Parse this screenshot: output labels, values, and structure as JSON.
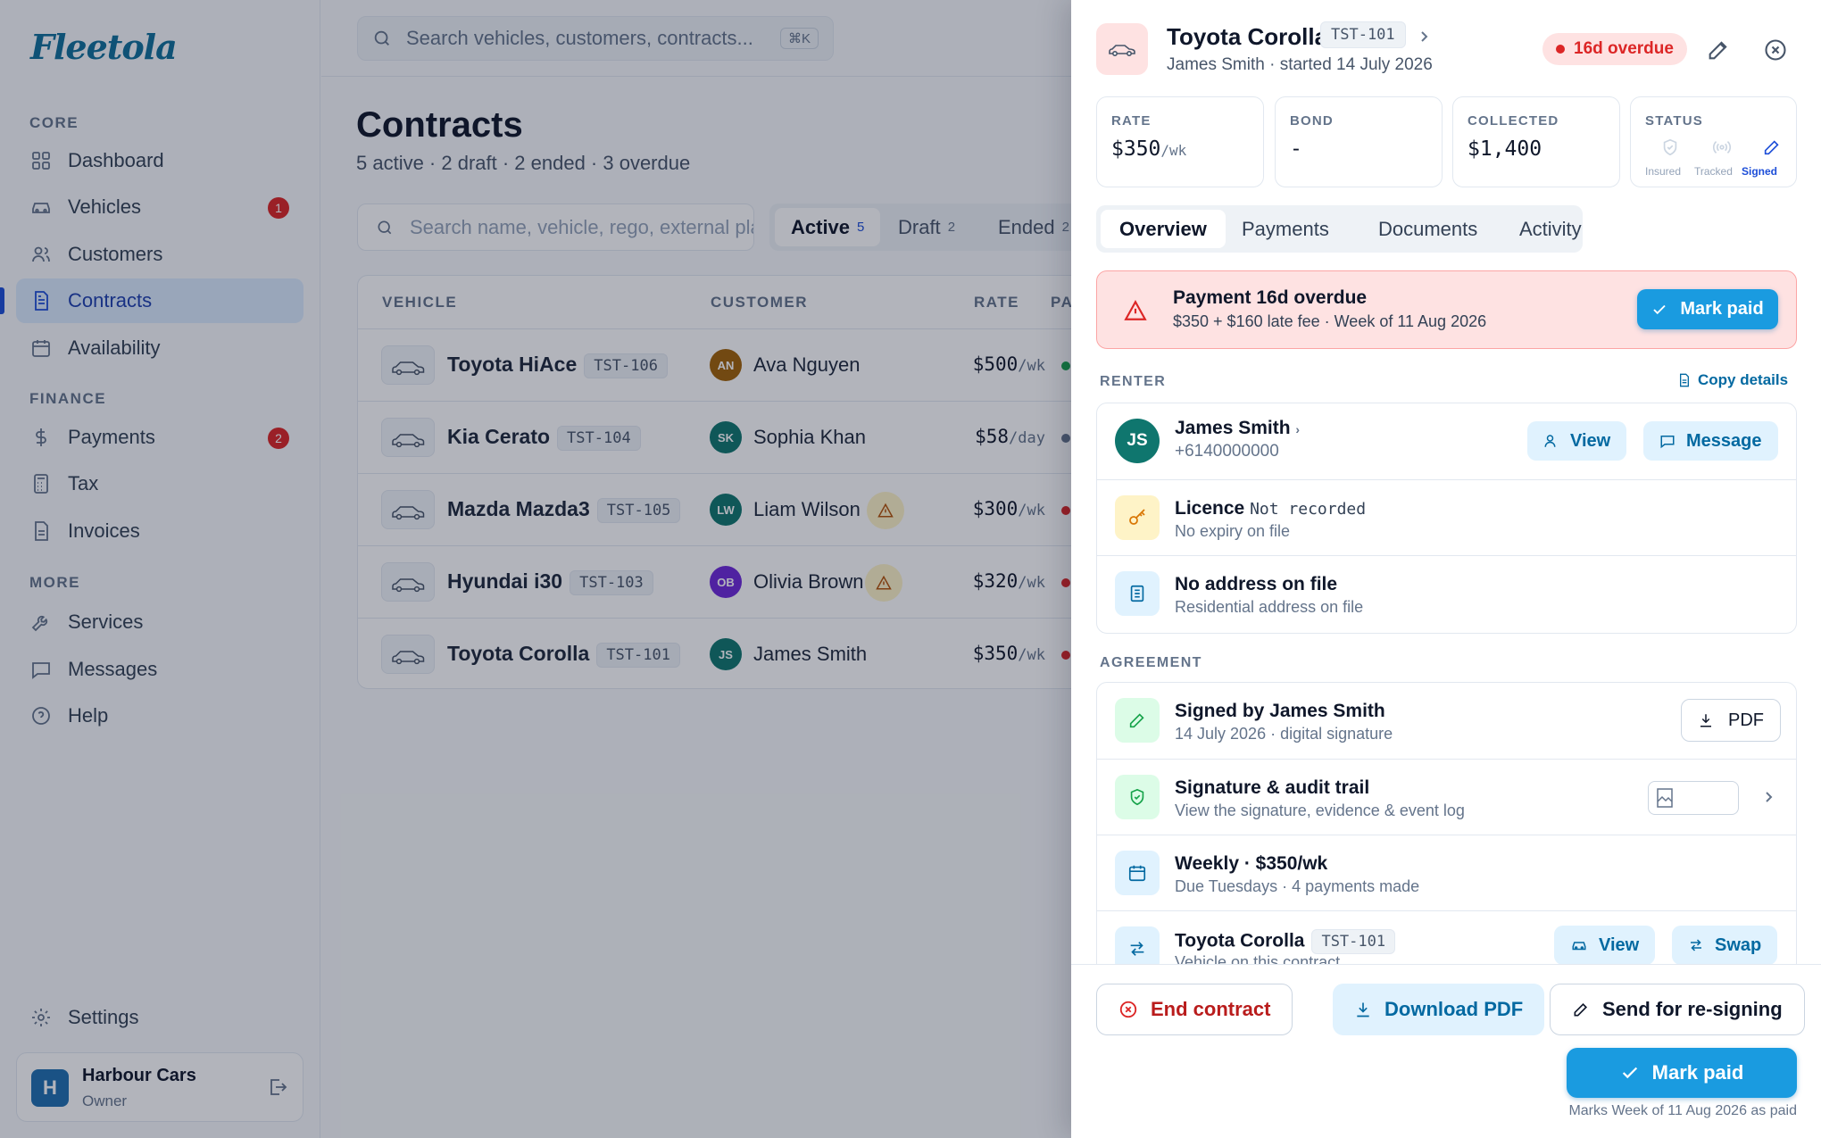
{
  "app": {
    "logo": "Fleetola"
  },
  "sidebar": {
    "sections": {
      "core": "CORE",
      "finance": "FINANCE",
      "more": "MORE"
    },
    "items": [
      {
        "label": "Dashboard",
        "icon": "dashboard-icon"
      },
      {
        "label": "Vehicles",
        "icon": "car-icon",
        "badge": "1"
      },
      {
        "label": "Customers",
        "icon": "users-icon"
      },
      {
        "label": "Contracts",
        "icon": "document-icon",
        "active": true
      },
      {
        "label": "Availability",
        "icon": "calendar-icon"
      },
      {
        "label": "Payments",
        "icon": "dollar-icon",
        "badge": "2"
      },
      {
        "label": "Tax",
        "icon": "calculator-icon"
      },
      {
        "label": "Invoices",
        "icon": "invoice-icon"
      },
      {
        "label": "Services",
        "icon": "wrench-icon"
      },
      {
        "label": "Messages",
        "icon": "message-icon"
      },
      {
        "label": "Help",
        "icon": "help-icon"
      },
      {
        "label": "Settings",
        "icon": "gear-icon"
      }
    ],
    "account": {
      "initial": "H",
      "name": "Harbour Cars",
      "role": "Owner"
    }
  },
  "topbar": {
    "search_placeholder": "Search vehicles, customers, contracts...",
    "shortcut": "⌘K"
  },
  "page": {
    "title": "Contracts",
    "subtitle": "5 active · 2 draft · 2 ended · 3 overdue",
    "filter_placeholder": "Search name, vehicle, rego, external pla",
    "segments": [
      {
        "label": "Active",
        "count": "5"
      },
      {
        "label": "Draft",
        "count": "2"
      },
      {
        "label": "Ended",
        "count": "2"
      }
    ],
    "columns": [
      "VEHICLE",
      "CUSTOMER",
      "RATE",
      "PA"
    ],
    "rows": [
      {
        "vehicle": "Toyota HiAce",
        "plate": "TST-106",
        "initials": "AN",
        "avatar_color": "#a16207",
        "customer": "Ava Nguyen",
        "warn": false,
        "rate": "$500",
        "unit": "/wk",
        "status_color": "#16a34a"
      },
      {
        "vehicle": "Kia Cerato",
        "plate": "TST-104",
        "initials": "SK",
        "avatar_color": "#0f766e",
        "customer": "Sophia Khan",
        "warn": false,
        "rate": "$58",
        "unit": "/day",
        "status_color": "#64748b"
      },
      {
        "vehicle": "Mazda Mazda3",
        "plate": "TST-105",
        "initials": "LW",
        "avatar_color": "#0f766e",
        "customer": "Liam Wilson",
        "warn": true,
        "rate": "$300",
        "unit": "/wk",
        "status_color": "#dc2626"
      },
      {
        "vehicle": "Hyundai i30",
        "plate": "TST-103",
        "initials": "OB",
        "avatar_color": "#6d28d9",
        "customer": "Olivia Brown",
        "warn": true,
        "rate": "$320",
        "unit": "/wk",
        "status_color": "#dc2626"
      },
      {
        "vehicle": "Toyota Corolla",
        "plate": "TST-101",
        "initials": "JS",
        "avatar_color": "#0f766e",
        "customer": "James Smith",
        "warn": false,
        "rate": "$350",
        "unit": "/wk",
        "status_color": "#dc2626"
      }
    ]
  },
  "panel": {
    "title": "Toyota Corolla",
    "plate": "TST-101",
    "subtitle": "James Smith · started 14 July 2026",
    "overdue_badge": "16d overdue",
    "stats": {
      "rate_label": "RATE",
      "rate_value": "$350",
      "rate_unit": "/wk",
      "bond_label": "BOND",
      "bond_value": "-",
      "collected_label": "COLLECTED",
      "collected_value": "$1,400",
      "status_label": "STATUS",
      "status_items": [
        "Insured",
        "Tracked",
        "Signed"
      ]
    },
    "tabs": [
      "Overview",
      "Payments",
      "Documents",
      "Activity"
    ],
    "alert": {
      "title": "Payment 16d overdue",
      "subtitle": "$350 + $160 late fee · Week of 11 Aug 2026",
      "button": "Mark paid"
    },
    "renter": {
      "label": "RENTER",
      "copy": "Copy details",
      "initials": "JS",
      "name": "James Smith",
      "phone": "+6140000000",
      "view": "View",
      "message": "Message",
      "licence_title": "Licence",
      "licence_value": "Not recorded",
      "licence_sub": "No expiry on file",
      "address_title": "No address on file",
      "address_sub": "Residential address on file"
    },
    "agreement": {
      "label": "AGREEMENT",
      "signed_title": "Signed by James Smith",
      "signed_sub": "14 July 2026 · digital signature",
      "pdf": "PDF",
      "audit_title": "Signature & audit trail",
      "audit_sub": "View the signature, evidence & event log",
      "schedule_title": "Weekly · $350/wk",
      "schedule_sub": "Due Tuesdays · 4 payments made",
      "vehicle_title": "Toyota Corolla",
      "vehicle_plate": "TST-101",
      "vehicle_sub": "Vehicle on this contract",
      "view": "View",
      "swap": "Swap"
    },
    "footer": {
      "end": "End contract",
      "download": "Download PDF",
      "resign": "Send for re-signing",
      "mark_paid": "Mark paid",
      "note": "Marks Week of 11 Aug 2026 as paid"
    }
  }
}
